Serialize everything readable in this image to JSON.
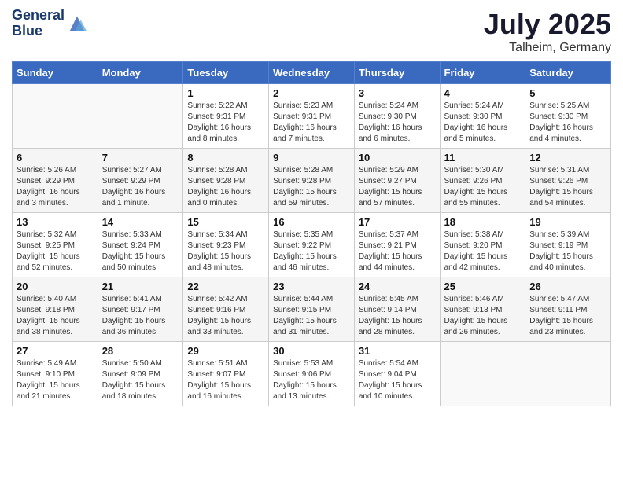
{
  "logo": {
    "line1": "General",
    "line2": "Blue"
  },
  "title": "July 2025",
  "location": "Talheim, Germany",
  "weekdays": [
    "Sunday",
    "Monday",
    "Tuesday",
    "Wednesday",
    "Thursday",
    "Friday",
    "Saturday"
  ],
  "weeks": [
    [
      {
        "day": "",
        "detail": ""
      },
      {
        "day": "",
        "detail": ""
      },
      {
        "day": "1",
        "detail": "Sunrise: 5:22 AM\nSunset: 9:31 PM\nDaylight: 16 hours and 8 minutes."
      },
      {
        "day": "2",
        "detail": "Sunrise: 5:23 AM\nSunset: 9:31 PM\nDaylight: 16 hours and 7 minutes."
      },
      {
        "day": "3",
        "detail": "Sunrise: 5:24 AM\nSunset: 9:30 PM\nDaylight: 16 hours and 6 minutes."
      },
      {
        "day": "4",
        "detail": "Sunrise: 5:24 AM\nSunset: 9:30 PM\nDaylight: 16 hours and 5 minutes."
      },
      {
        "day": "5",
        "detail": "Sunrise: 5:25 AM\nSunset: 9:30 PM\nDaylight: 16 hours and 4 minutes."
      }
    ],
    [
      {
        "day": "6",
        "detail": "Sunrise: 5:26 AM\nSunset: 9:29 PM\nDaylight: 16 hours and 3 minutes."
      },
      {
        "day": "7",
        "detail": "Sunrise: 5:27 AM\nSunset: 9:29 PM\nDaylight: 16 hours and 1 minute."
      },
      {
        "day": "8",
        "detail": "Sunrise: 5:28 AM\nSunset: 9:28 PM\nDaylight: 16 hours and 0 minutes."
      },
      {
        "day": "9",
        "detail": "Sunrise: 5:28 AM\nSunset: 9:28 PM\nDaylight: 15 hours and 59 minutes."
      },
      {
        "day": "10",
        "detail": "Sunrise: 5:29 AM\nSunset: 9:27 PM\nDaylight: 15 hours and 57 minutes."
      },
      {
        "day": "11",
        "detail": "Sunrise: 5:30 AM\nSunset: 9:26 PM\nDaylight: 15 hours and 55 minutes."
      },
      {
        "day": "12",
        "detail": "Sunrise: 5:31 AM\nSunset: 9:26 PM\nDaylight: 15 hours and 54 minutes."
      }
    ],
    [
      {
        "day": "13",
        "detail": "Sunrise: 5:32 AM\nSunset: 9:25 PM\nDaylight: 15 hours and 52 minutes."
      },
      {
        "day": "14",
        "detail": "Sunrise: 5:33 AM\nSunset: 9:24 PM\nDaylight: 15 hours and 50 minutes."
      },
      {
        "day": "15",
        "detail": "Sunrise: 5:34 AM\nSunset: 9:23 PM\nDaylight: 15 hours and 48 minutes."
      },
      {
        "day": "16",
        "detail": "Sunrise: 5:35 AM\nSunset: 9:22 PM\nDaylight: 15 hours and 46 minutes."
      },
      {
        "day": "17",
        "detail": "Sunrise: 5:37 AM\nSunset: 9:21 PM\nDaylight: 15 hours and 44 minutes."
      },
      {
        "day": "18",
        "detail": "Sunrise: 5:38 AM\nSunset: 9:20 PM\nDaylight: 15 hours and 42 minutes."
      },
      {
        "day": "19",
        "detail": "Sunrise: 5:39 AM\nSunset: 9:19 PM\nDaylight: 15 hours and 40 minutes."
      }
    ],
    [
      {
        "day": "20",
        "detail": "Sunrise: 5:40 AM\nSunset: 9:18 PM\nDaylight: 15 hours and 38 minutes."
      },
      {
        "day": "21",
        "detail": "Sunrise: 5:41 AM\nSunset: 9:17 PM\nDaylight: 15 hours and 36 minutes."
      },
      {
        "day": "22",
        "detail": "Sunrise: 5:42 AM\nSunset: 9:16 PM\nDaylight: 15 hours and 33 minutes."
      },
      {
        "day": "23",
        "detail": "Sunrise: 5:44 AM\nSunset: 9:15 PM\nDaylight: 15 hours and 31 minutes."
      },
      {
        "day": "24",
        "detail": "Sunrise: 5:45 AM\nSunset: 9:14 PM\nDaylight: 15 hours and 28 minutes."
      },
      {
        "day": "25",
        "detail": "Sunrise: 5:46 AM\nSunset: 9:13 PM\nDaylight: 15 hours and 26 minutes."
      },
      {
        "day": "26",
        "detail": "Sunrise: 5:47 AM\nSunset: 9:11 PM\nDaylight: 15 hours and 23 minutes."
      }
    ],
    [
      {
        "day": "27",
        "detail": "Sunrise: 5:49 AM\nSunset: 9:10 PM\nDaylight: 15 hours and 21 minutes."
      },
      {
        "day": "28",
        "detail": "Sunrise: 5:50 AM\nSunset: 9:09 PM\nDaylight: 15 hours and 18 minutes."
      },
      {
        "day": "29",
        "detail": "Sunrise: 5:51 AM\nSunset: 9:07 PM\nDaylight: 15 hours and 16 minutes."
      },
      {
        "day": "30",
        "detail": "Sunrise: 5:53 AM\nSunset: 9:06 PM\nDaylight: 15 hours and 13 minutes."
      },
      {
        "day": "31",
        "detail": "Sunrise: 5:54 AM\nSunset: 9:04 PM\nDaylight: 15 hours and 10 minutes."
      },
      {
        "day": "",
        "detail": ""
      },
      {
        "day": "",
        "detail": ""
      }
    ]
  ]
}
